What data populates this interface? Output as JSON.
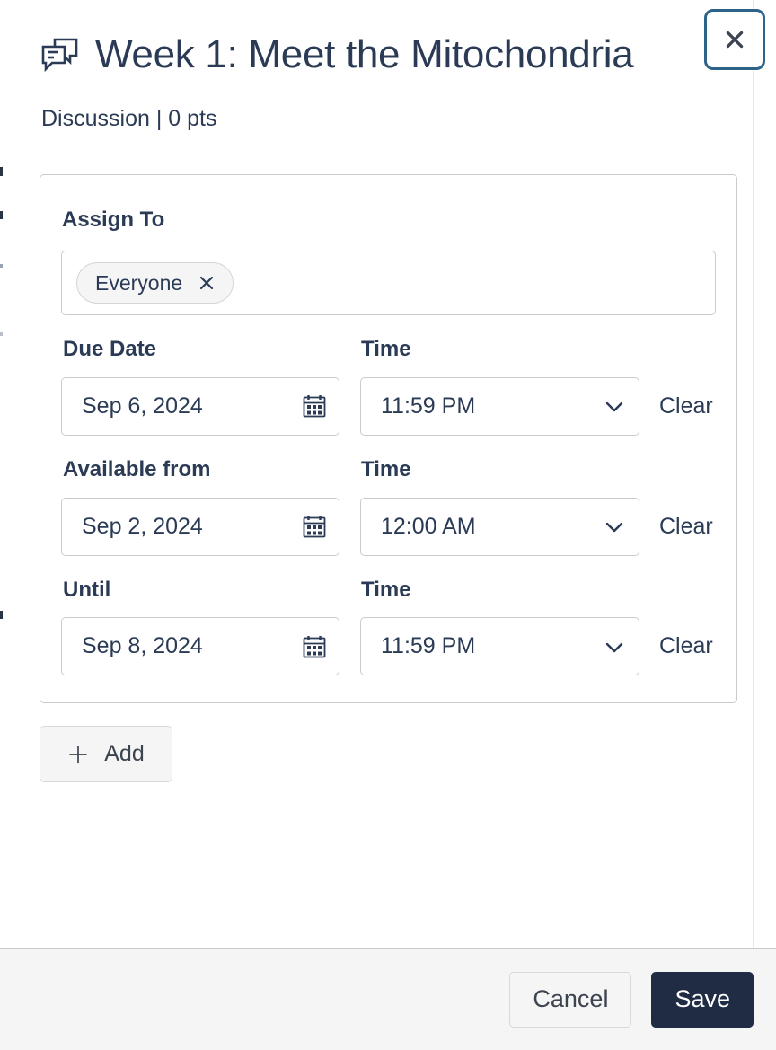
{
  "modal": {
    "icon": "discussion-icon",
    "title": "Week 1: Meet the Mitochondria",
    "subtitle": "Discussion | 0 pts",
    "close_icon": "close-icon",
    "close_label": "Close"
  },
  "assign_card": {
    "assign_to_label": "Assign To",
    "tokens": [
      {
        "label": "Everyone",
        "remove_icon": "x-icon"
      }
    ],
    "rows": [
      {
        "date_label": "Due Date",
        "date_value": "Sep 6, 2024",
        "date_icon": "calendar-icon",
        "time_label": "Time",
        "time_value": "11:59 PM",
        "time_icon": "chevron-down-icon",
        "clear_label": "Clear"
      },
      {
        "date_label": "Available from",
        "date_value": "Sep 2, 2024",
        "date_icon": "calendar-icon",
        "time_label": "Time",
        "time_value": "12:00 AM",
        "time_icon": "chevron-down-icon",
        "clear_label": "Clear"
      },
      {
        "date_label": "Until",
        "date_value": "Sep 8, 2024",
        "date_icon": "calendar-icon",
        "time_label": "Time",
        "time_value": "11:59 PM",
        "time_icon": "chevron-down-icon",
        "clear_label": "Clear"
      }
    ]
  },
  "add_button": {
    "label": "Add",
    "icon": "plus-icon"
  },
  "footer": {
    "cancel_label": "Cancel",
    "save_label": "Save"
  },
  "colors": {
    "text_primary": "#2b3b56",
    "save_background": "#1f2c44",
    "focus_ring": "#2d6389",
    "footer_background": "#f5f5f5",
    "border": "#c8ccd1",
    "token_background": "#f5f5f5"
  }
}
